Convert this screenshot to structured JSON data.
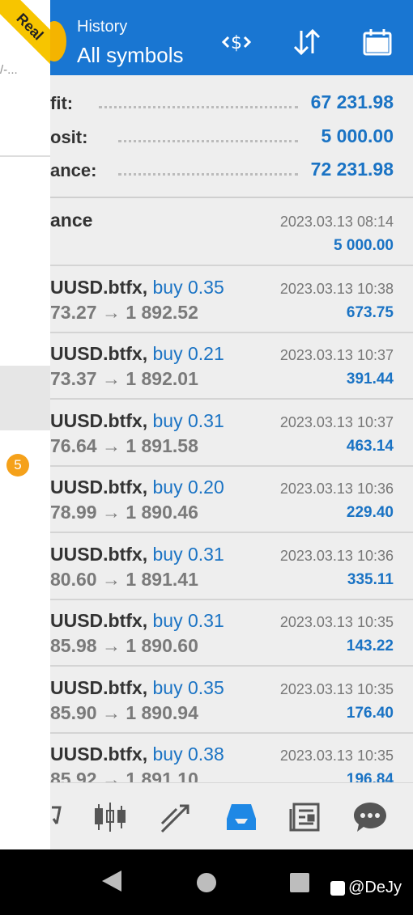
{
  "header": {
    "title": "History",
    "subtitle": "All symbols",
    "icons": [
      "symbol-filter-icon",
      "sort-icon",
      "calendar-icon"
    ]
  },
  "summary": [
    {
      "label": "fit:",
      "value": "67 231.98"
    },
    {
      "label": "osit:",
      "value": "5 000.00"
    },
    {
      "label": "ance:",
      "value": "72 231.98"
    }
  ],
  "balance_item": {
    "label": "ance",
    "time": "2023.03.13 08:14",
    "amount": "5 000.00"
  },
  "trades": [
    {
      "symbol": "UUSD.btfx,",
      "side": "buy 0.35",
      "prices": "73.27 → 1 892.52",
      "time": "2023.03.13 10:38",
      "profit": "673.75"
    },
    {
      "symbol": "UUSD.btfx,",
      "side": "buy 0.21",
      "prices": "73.37 → 1 892.01",
      "time": "2023.03.13 10:37",
      "profit": "391.44"
    },
    {
      "symbol": "UUSD.btfx,",
      "side": "buy 0.31",
      "prices": "76.64 → 1 891.58",
      "time": "2023.03.13 10:37",
      "profit": "463.14"
    },
    {
      "symbol": "UUSD.btfx,",
      "side": "buy 0.20",
      "prices": "78.99 → 1 890.46",
      "time": "2023.03.13 10:36",
      "profit": "229.40"
    },
    {
      "symbol": "UUSD.btfx,",
      "side": "buy 0.31",
      "prices": "80.60 → 1 891.41",
      "time": "2023.03.13 10:36",
      "profit": "335.11"
    },
    {
      "symbol": "UUSD.btfx,",
      "side": "buy 0.31",
      "prices": "85.98 → 1 890.60",
      "time": "2023.03.13 10:35",
      "profit": "143.22"
    },
    {
      "symbol": "UUSD.btfx,",
      "side": "buy 0.35",
      "prices": "85.90 → 1 890.94",
      "time": "2023.03.13 10:35",
      "profit": "176.40"
    },
    {
      "symbol": "UUSD.btfx,",
      "side": "buy 0.38",
      "prices": "85.92 → 1 891.10",
      "time": "2023.03.13 10:35",
      "profit": "196.84"
    }
  ],
  "bottom_nav": [
    "quotes-icon",
    "chart-candles-icon",
    "trade-icon",
    "history-icon",
    "news-icon",
    "messages-icon"
  ],
  "drawer": {
    "account_text": "/-...",
    "badge": "5",
    "ribbon": "Real"
  },
  "watermark": "@DeJy",
  "colors": {
    "header": "#1976d2",
    "accent": "#1a73c4",
    "badge": "#f5a11a",
    "ribbon": "#f7c500"
  }
}
